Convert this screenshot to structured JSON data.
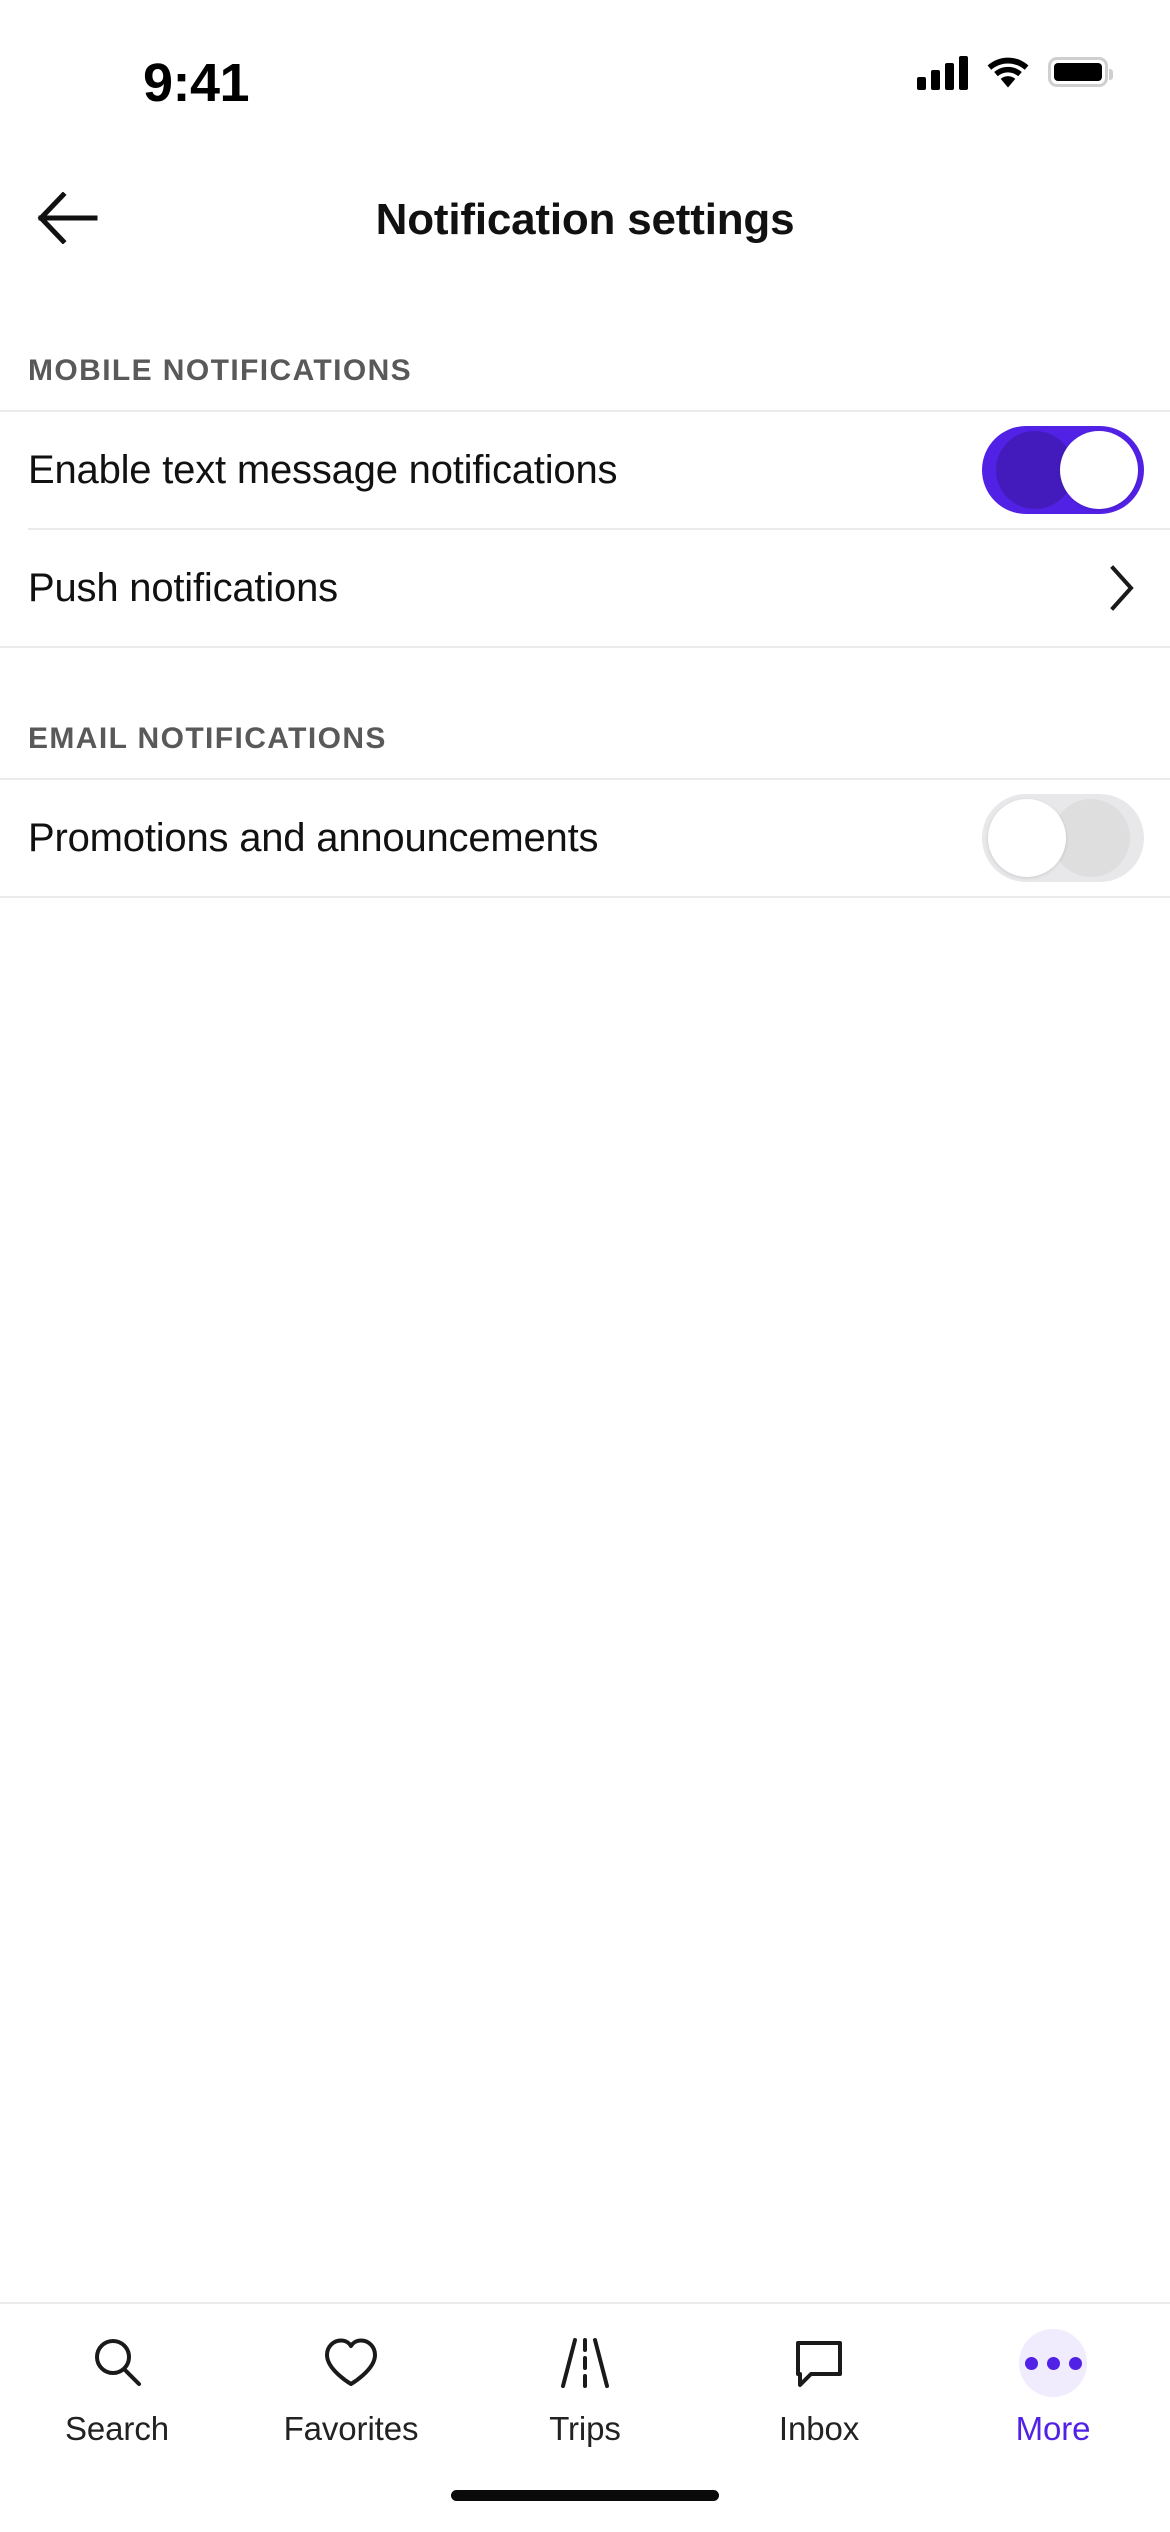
{
  "status_bar": {
    "time": "9:41",
    "cellular_icon": "signal-bars-icon",
    "wifi_icon": "wifi-icon",
    "battery_icon": "battery-full-icon"
  },
  "header": {
    "back_icon": "arrow-left-icon",
    "title": "Notification settings"
  },
  "sections": [
    {
      "title": "MOBILE NOTIFICATIONS",
      "rows": [
        {
          "label": "Enable text message notifications",
          "control": "toggle",
          "state": "on"
        },
        {
          "label": "Push notifications",
          "control": "chevron",
          "chevron_icon": "chevron-right-icon"
        }
      ]
    },
    {
      "title": "EMAIL NOTIFICATIONS",
      "rows": [
        {
          "label": "Promotions and announcements",
          "control": "toggle",
          "state": "off"
        }
      ]
    }
  ],
  "tab_bar": {
    "items": [
      {
        "label": "Search",
        "icon": "search-icon",
        "active": false
      },
      {
        "label": "Favorites",
        "icon": "heart-icon",
        "active": false
      },
      {
        "label": "Trips",
        "icon": "road-icon",
        "active": false
      },
      {
        "label": "Inbox",
        "icon": "chat-bubble-icon",
        "active": false
      },
      {
        "label": "More",
        "icon": "ellipsis-icon",
        "active": true
      }
    ]
  },
  "colors": {
    "accent": "#5221e6",
    "accent_soft": "#f0ebfd",
    "toggle_off": "#e8e8ea",
    "divider": "#ebebeb",
    "section_label": "#595959",
    "text_primary": "#111111"
  },
  "home_indicator": "home-indicator"
}
